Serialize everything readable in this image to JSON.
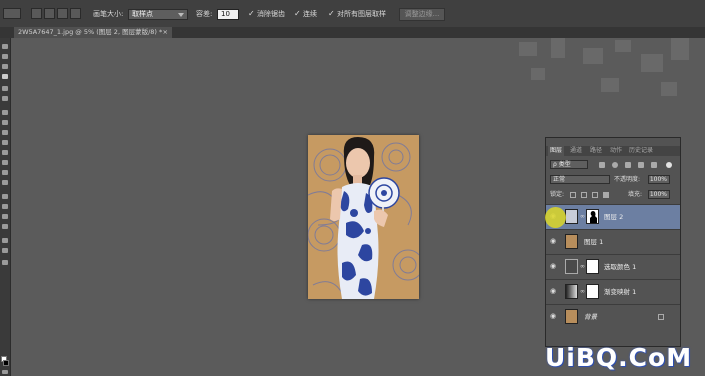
{
  "options_bar": {
    "brush_size_label": "画笔大小:",
    "brush_size_value": "取样点",
    "tolerance_label": "容差:",
    "tolerance_value": "10",
    "antialias_label": "消除锯齿",
    "contiguous_label": "连续",
    "sample_all_label": "对所有图层取样",
    "refine_edge_label": "调整边缘..."
  },
  "document_tab": {
    "title": "2W5A7647_1.jpg @ 5% (图层 2, 图层蒙版/8) *",
    "close_glyph": "×"
  },
  "layers_panel": {
    "tabs": [
      "图层",
      "通道",
      "路径",
      "动作",
      "历史记录"
    ],
    "active_tab": 0,
    "filter_kind": "ρ 类型",
    "blend_mode": "正常",
    "opacity_label": "不透明度:",
    "opacity_value": "100%",
    "lock_label": "锁定:",
    "fill_label": "填充:",
    "fill_value": "100%",
    "layers": [
      {
        "name": "图层 2",
        "selected": true,
        "thumb": "photo",
        "mask": "silhouette"
      },
      {
        "name": "图层 1",
        "selected": false,
        "thumb": "photo",
        "mask": ""
      },
      {
        "name": "选取颜色 1",
        "selected": false,
        "thumb": "adjustment-selective-color",
        "mask": "white"
      },
      {
        "name": "渐变映射 1",
        "selected": false,
        "thumb": "adjustment-gradient-map",
        "mask": "white"
      },
      {
        "name": "背景",
        "selected": false,
        "thumb": "photo",
        "mask": "",
        "locked": true
      }
    ]
  },
  "watermark": "UiBQ.CoM",
  "colors": {
    "app_bg": "#404040",
    "canvas_bg": "#5b5b5b",
    "selected_layer": "#6c7fa2",
    "photo_bg": "#c69a62",
    "dress_blue": "#2d46a0",
    "cursor_yellow": "#dcd728"
  }
}
